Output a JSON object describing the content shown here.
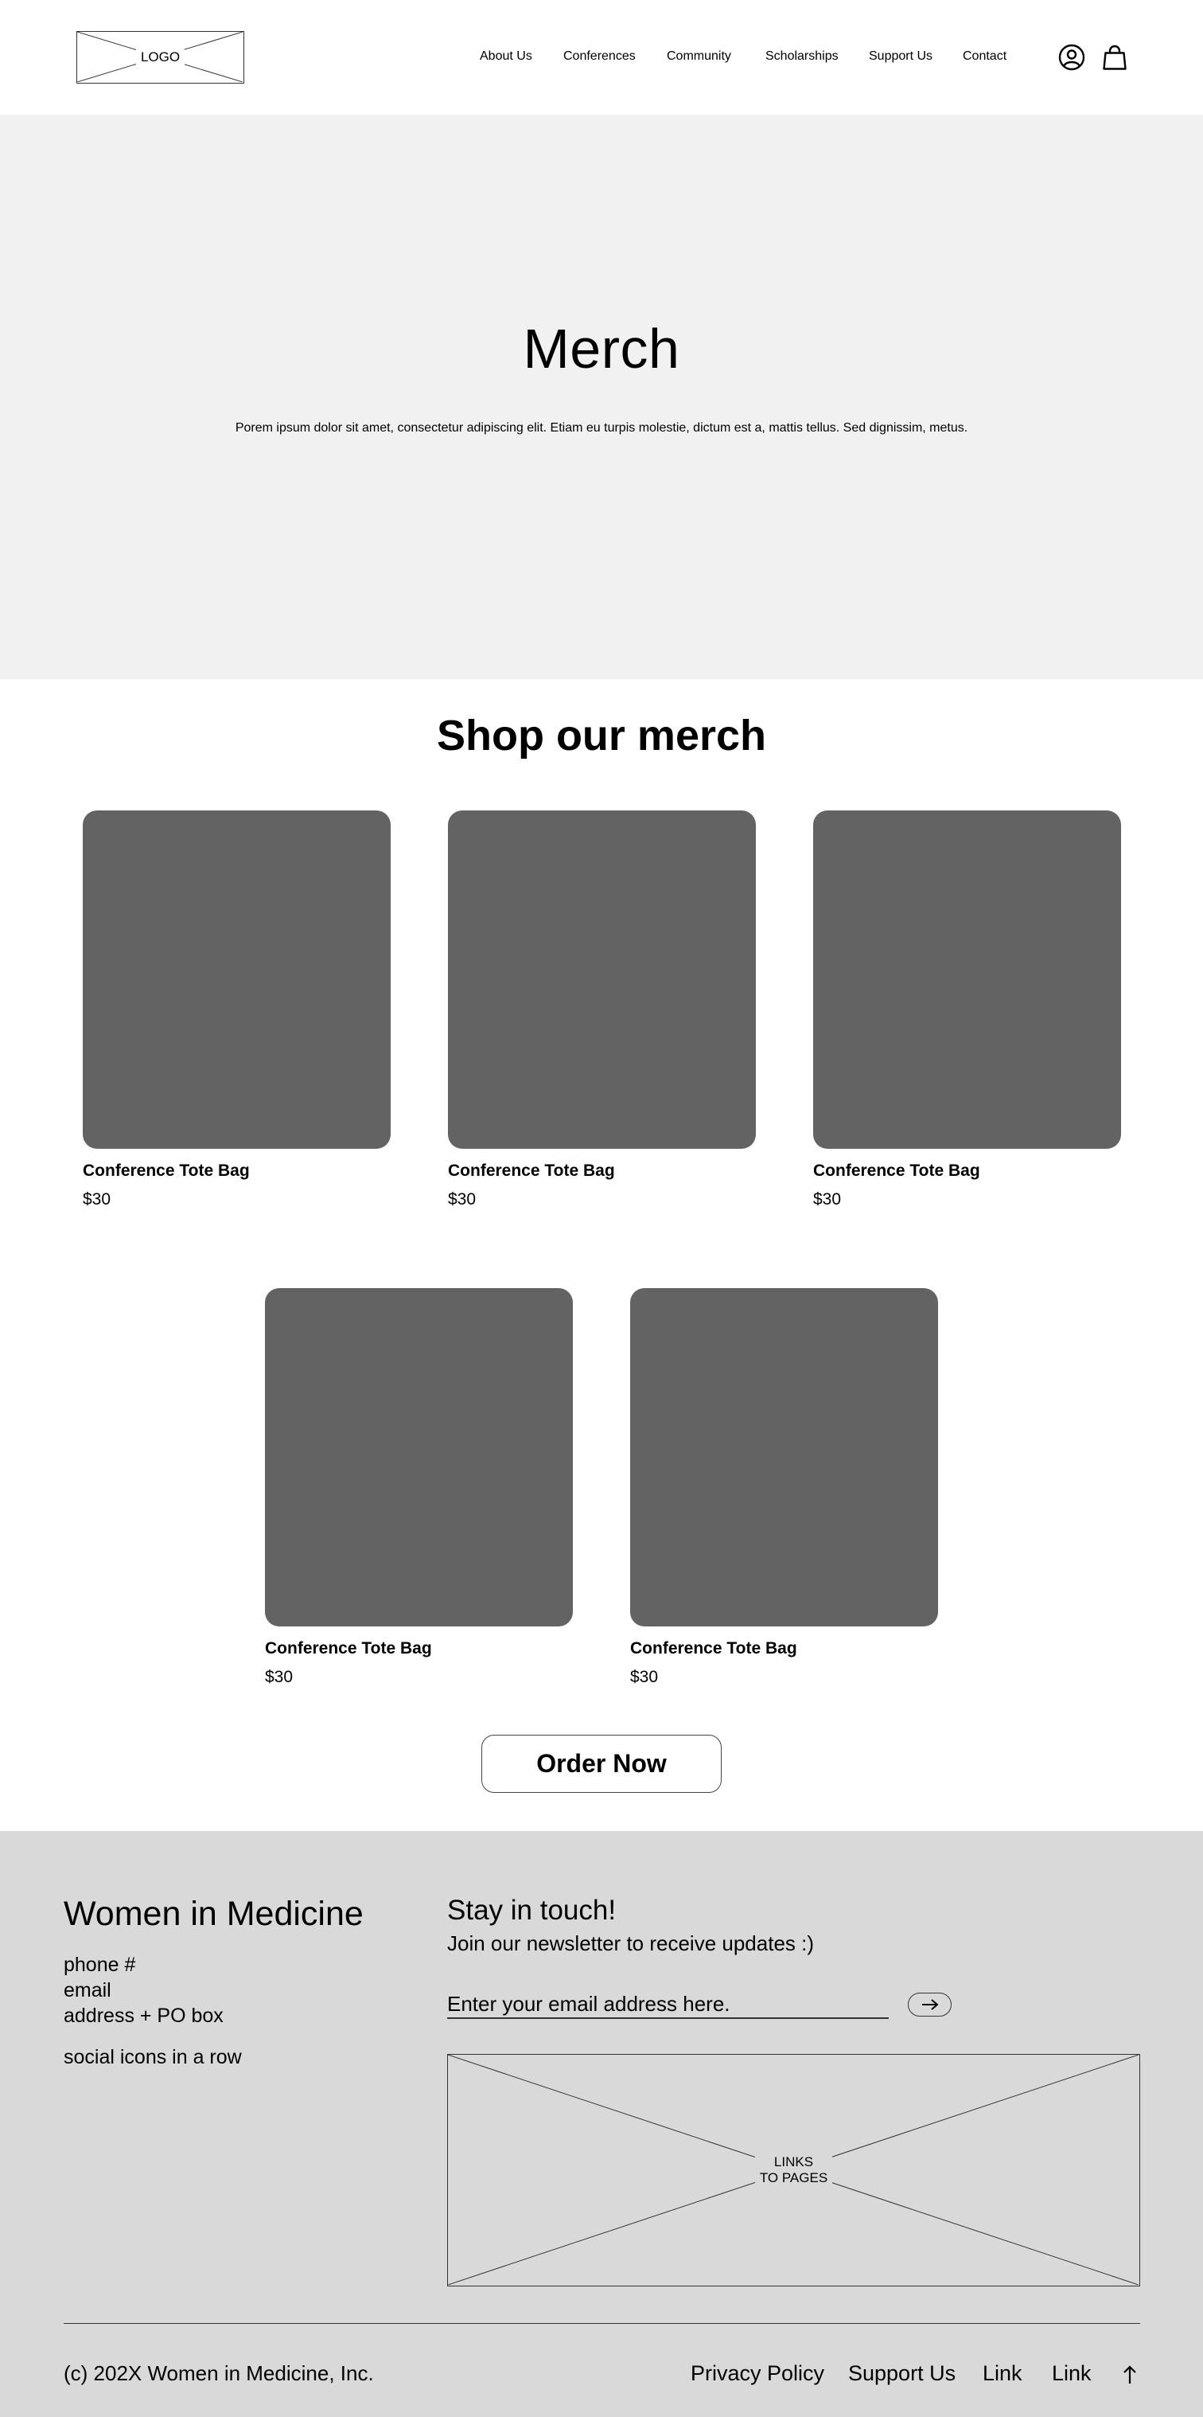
{
  "header": {
    "logo_label": "LOGO",
    "nav": [
      {
        "label": "About Us"
      },
      {
        "label": "Conferences"
      },
      {
        "label": "Community"
      },
      {
        "label": "Scholarships"
      },
      {
        "label": "Support Us"
      },
      {
        "label": "Contact"
      }
    ],
    "icons": [
      "account-icon",
      "shopping-bag-icon"
    ]
  },
  "hero": {
    "title": "Merch",
    "text": "Porem ipsum dolor sit amet, consectetur adipiscing elit. Etiam eu turpis molestie, dictum est a, mattis tellus. Sed dignissim, metus.",
    "background": "#f1f1f1"
  },
  "shop": {
    "title": "Shop our merch",
    "products": [
      {
        "name": "Conference Tote Bag",
        "price": "$30"
      },
      {
        "name": "Conference Tote Bag",
        "price": "$30"
      },
      {
        "name": "Conference Tote Bag",
        "price": "$30"
      },
      {
        "name": "Conference Tote Bag",
        "price": "$30"
      },
      {
        "name": "Conference Tote Bag",
        "price": "$30"
      }
    ],
    "image_color": "#636363",
    "order_label": "Order Now"
  },
  "footer": {
    "org_name": "Women in Medicine",
    "phone": "phone #",
    "email": "email",
    "address": "address + PO box",
    "social": "social icons in a row",
    "newsletter_title": "Stay in touch!",
    "newsletter_sub": "Join our newsletter to receive updates :)",
    "email_placeholder": "Enter your email address here.",
    "links_placeholder": "LINKS\nTO PAGES",
    "copyright": "(c) 202X Women in Medicine, Inc.",
    "links": [
      {
        "label": "Privacy Policy"
      },
      {
        "label": "Support Us"
      },
      {
        "label": "Link"
      },
      {
        "label": "Link"
      }
    ],
    "background": "#d9d9d9"
  }
}
